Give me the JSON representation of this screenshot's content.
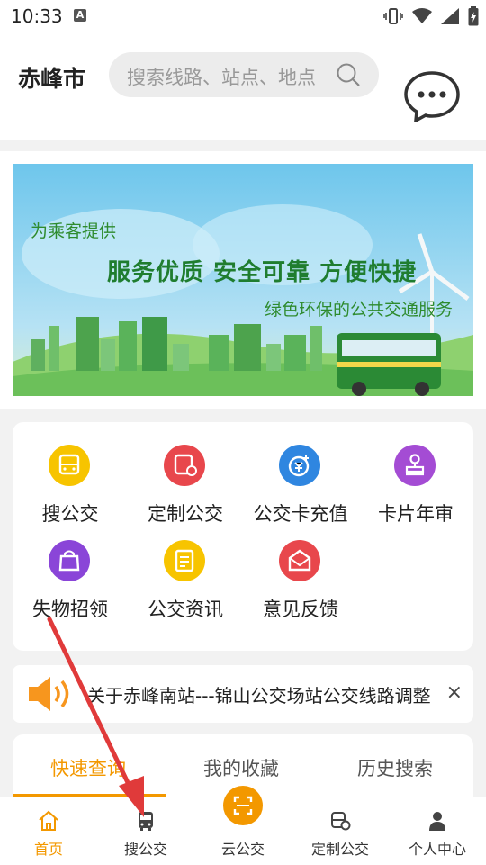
{
  "status_bar": {
    "time": "10:33",
    "notification_letter": "A"
  },
  "header": {
    "city": "赤峰市",
    "search_placeholder": "搜索线路、站点、地点",
    "message_icon": "chat-bubble-icon"
  },
  "banner": {
    "tagline_small": "为乘客提供",
    "tagline_big": "服务优质 安全可靠 方便快捷",
    "tagline_sub": "绿色环保的公共交通服务"
  },
  "grid": {
    "items": [
      {
        "label": "搜公交",
        "icon": "bus-search-icon",
        "color": "#f7c400"
      },
      {
        "label": "定制公交",
        "icon": "custom-bus-icon",
        "color": "#e8474c"
      },
      {
        "label": "公交卡充值",
        "icon": "card-recharge-icon",
        "color": "#2f86e0"
      },
      {
        "label": "卡片年审",
        "icon": "stamp-icon",
        "color": "#a44cd4"
      },
      {
        "label": "失物招领",
        "icon": "lost-found-bag-icon",
        "color": "#8a45d8"
      },
      {
        "label": "公交资讯",
        "icon": "news-icon",
        "color": "#f7c400"
      },
      {
        "label": "意见反馈",
        "icon": "feedback-mail-icon",
        "color": "#e8474c"
      }
    ]
  },
  "notice": {
    "text": "关于赤峰南站---锦山公交场站公交线路调整",
    "close": "×"
  },
  "tabs": {
    "items": [
      "快速查询",
      "我的收藏",
      "历史搜索"
    ],
    "active_index": 0
  },
  "bottom_nav": {
    "items": [
      {
        "label": "首页",
        "icon": "home-icon",
        "active": true
      },
      {
        "label": "搜公交",
        "icon": "bus-icon",
        "active": false
      },
      {
        "label": "云公交",
        "icon": "scan-icon",
        "active": false
      },
      {
        "label": "定制公交",
        "icon": "custom-bus-icon",
        "active": false
      },
      {
        "label": "个人中心",
        "icon": "person-icon",
        "active": false
      }
    ]
  },
  "colors": {
    "accent": "#f39800",
    "annotation": "#e03a3a"
  }
}
